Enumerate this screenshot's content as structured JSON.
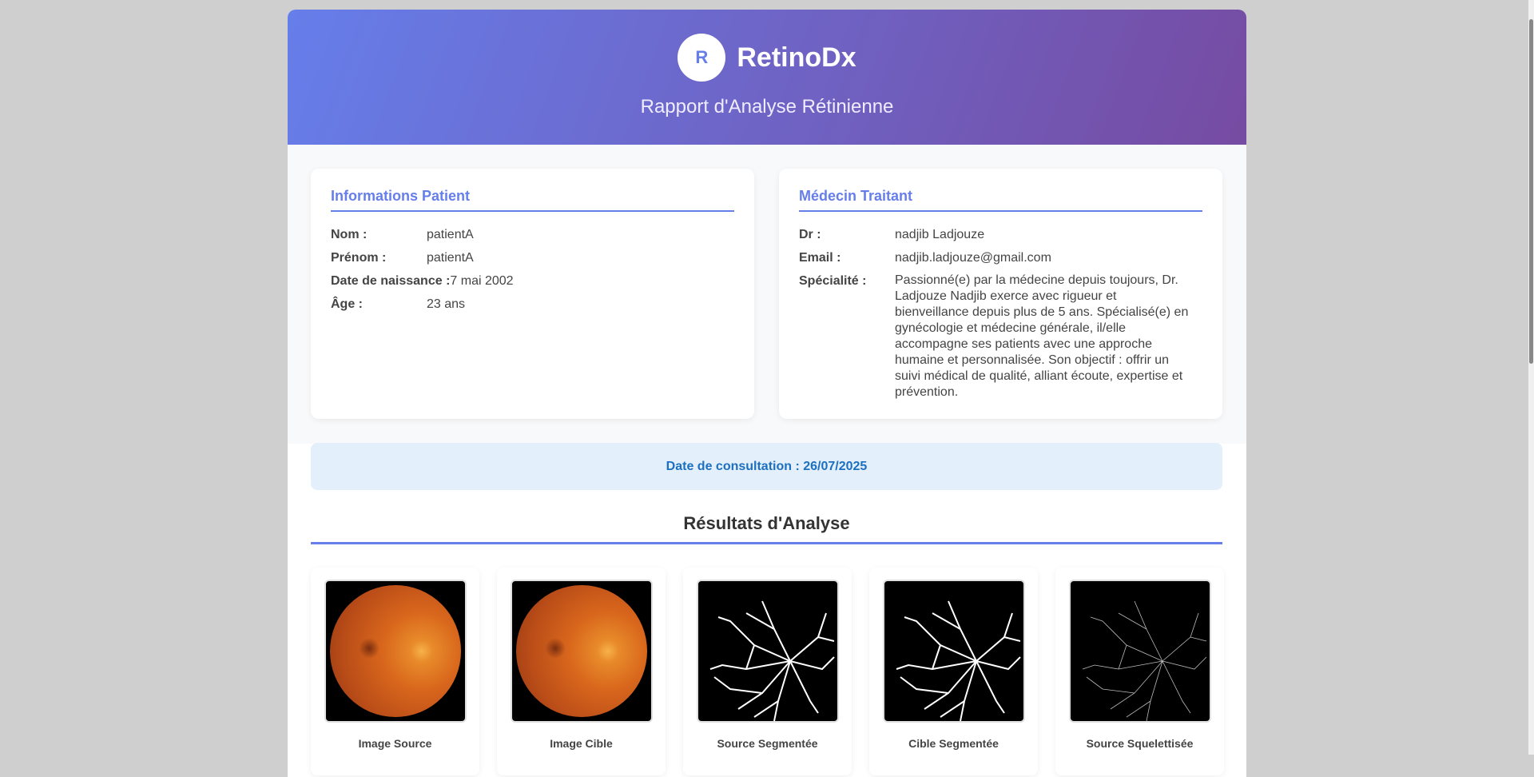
{
  "header": {
    "logo_letter": "R",
    "brand": "RetinoDx",
    "subtitle": "Rapport d'Analyse Rétinienne"
  },
  "patient": {
    "title": "Informations Patient",
    "rows": [
      {
        "label": "Nom :",
        "value": "patientA"
      },
      {
        "label": "Prénom :",
        "value": "patientA"
      },
      {
        "label": "Date de naissance :",
        "value": "7 mai 2002"
      },
      {
        "label": "Âge :",
        "value": "23 ans"
      }
    ]
  },
  "doctor": {
    "title": "Médecin Traitant",
    "rows": [
      {
        "label": "Dr :",
        "value": "nadjib Ladjouze"
      },
      {
        "label": "Email :",
        "value": "nadjib.ladjouze@gmail.com"
      },
      {
        "label": "Spécialité :",
        "value": "Passionné(e) par la médecine depuis toujours, Dr. Ladjouze Nadjib exerce avec rigueur et bienveillance depuis plus de 5 ans. Spécialisé(e) en gynécologie et médecine générale, il/elle accompagne ses patients avec une approche humaine et personnalisée. Son objectif : offrir un suivi médical de qualité, alliant écoute, expertise et prévention."
      }
    ]
  },
  "consultation": "Date de consultation : 26/07/2025",
  "results": {
    "title": "Résultats d'Analyse",
    "images": [
      {
        "label": "Image Source"
      },
      {
        "label": "Image Cible"
      },
      {
        "label": "Source Segmentée"
      },
      {
        "label": "Cible Segmentée"
      },
      {
        "label": "Source Squelettisée"
      }
    ]
  }
}
